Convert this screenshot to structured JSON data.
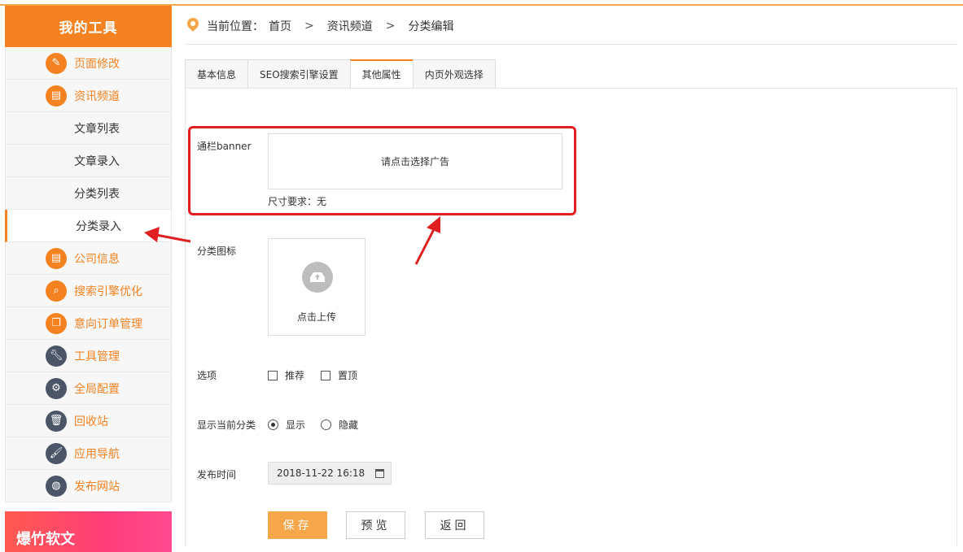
{
  "sidebar": {
    "title": "我的工具",
    "items": [
      {
        "label": "页面修改",
        "icon": "pencil-icon"
      },
      {
        "label": "资讯频道",
        "icon": "news-icon"
      },
      {
        "label": "文章列表"
      },
      {
        "label": "文章录入"
      },
      {
        "label": "分类列表"
      },
      {
        "label": "分类录入"
      },
      {
        "label": "公司信息",
        "icon": "company-icon"
      },
      {
        "label": "搜索引擎优化",
        "icon": "search-icon"
      },
      {
        "label": "意向订单管理",
        "icon": "order-icon"
      },
      {
        "label": "工具管理",
        "icon": "wrench-icon"
      },
      {
        "label": "全局配置",
        "icon": "gear-icon"
      },
      {
        "label": "回收站",
        "icon": "trash-icon"
      },
      {
        "label": "应用导航",
        "icon": "brush-icon"
      },
      {
        "label": "发布网站",
        "icon": "globe-icon"
      }
    ],
    "promo": "爆竹软文"
  },
  "breadcrumb": {
    "prefix": "当前位置：",
    "items": [
      "首页",
      "资讯频道",
      "分类编辑"
    ],
    "sep": ">"
  },
  "tabs": [
    {
      "label": "基本信息"
    },
    {
      "label": "SEO搜索引擎设置"
    },
    {
      "label": "其他属性"
    },
    {
      "label": "内页外观选择"
    }
  ],
  "form": {
    "banner_label": "通栏banner",
    "banner_button": "请点击选择广告",
    "banner_hint": "尺寸要求：无",
    "icon_label": "分类图标",
    "upload_text": "点击上传",
    "options_label": "选项",
    "opt_recommend": "推荐",
    "opt_top": "置顶",
    "show_label": "显示当前分类",
    "show_on": "显示",
    "show_off": "隐藏",
    "time_label": "发布时间",
    "time_value": "2018-11-22 16:18"
  },
  "buttons": {
    "save": "保存",
    "preview": "预览",
    "back": "返回"
  },
  "colors": {
    "accent": "#f48221",
    "highlight": "#e02020"
  }
}
